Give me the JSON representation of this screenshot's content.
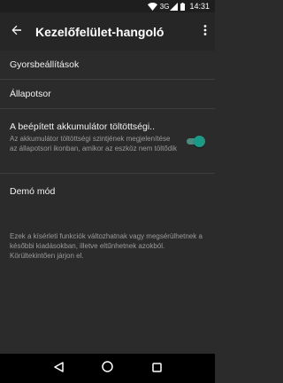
{
  "status_bar": {
    "network": "3G",
    "time": "14:31",
    "icons": [
      "wifi-icon",
      "signal-icon",
      "battery-icon"
    ]
  },
  "app_bar": {
    "title": "Kezelőfelület-hangoló",
    "icons": [
      "back-arrow-icon",
      "more-vert-icon"
    ]
  },
  "settings": {
    "items": [
      {
        "title": "Gyorsbeállítások"
      },
      {
        "title": "Állapotsor"
      },
      {
        "title": "A beépített akkumulátor töltöttségi..",
        "subtitle": "Az akkumulátor töltöttségi szintjének megjelenítése az állapotsori ikonban, amikor az eszköz nem töltődik",
        "toggle_on": true
      },
      {
        "title": "Demó mód"
      }
    ],
    "footer": "Ezek a kísérleti funkciók változhatnak vagy megsérülhetnek a későbbi kiadásokban, illetve eltűnhetnek azokból. Körültekintően járjon el."
  },
  "nav_bar": {
    "icons": [
      "back-triangle-icon",
      "home-circle-icon",
      "recents-square-icon"
    ]
  },
  "colors": {
    "background": "#2b2b2b",
    "app_bar": "#262626",
    "accent": "#1b9a87"
  }
}
